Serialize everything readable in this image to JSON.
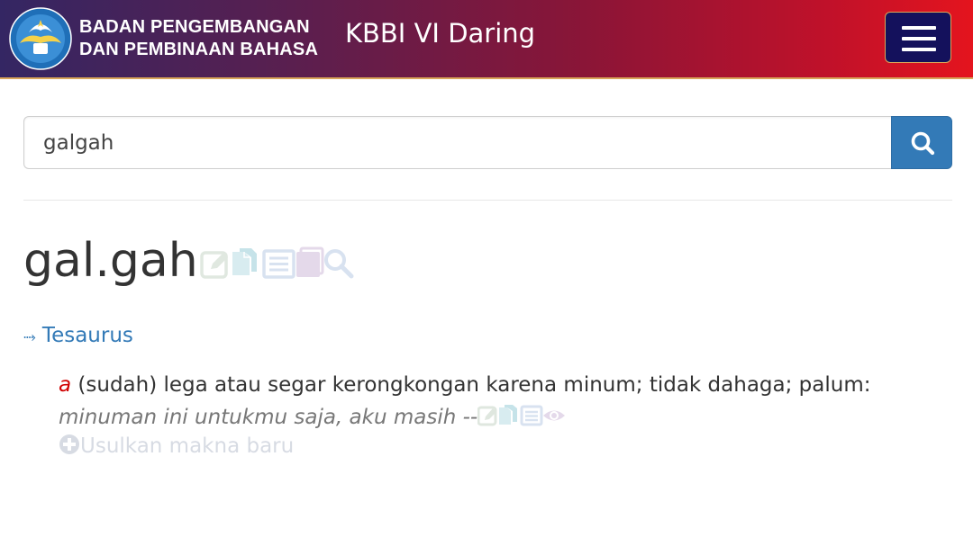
{
  "header": {
    "org_line1": "BADAN PENGEMBANGAN",
    "org_line2": "DAN PEMBINAAN BAHASA",
    "app_title": "KBBI VI Daring",
    "logo_icon": "tut-wuri-handayani-logo-icon",
    "menu_icon": "hamburger-icon"
  },
  "search": {
    "value": "galgah",
    "button_icon": "search-icon"
  },
  "entry": {
    "headword": "gal.gah",
    "tools_icons": [
      "edit-icon",
      "copy-icon",
      "list-icon",
      "book-icon",
      "search-icon"
    ],
    "tesaurus_link": "Tesaurus",
    "tesaurus_prefix": "⤑",
    "definitions": [
      {
        "pos": "a",
        "text": " (sudah) lega atau segar kerongkongan karena minum; tidak dahaga; palum: ",
        "example": "minuman ini untukmu saja, aku masih --",
        "tools_icons": [
          "edit-icon",
          "copy-icon",
          "list-icon",
          "eye-icon"
        ]
      }
    ],
    "suggest_link": "Usulkan makna baru",
    "suggest_icon": "plus-circle-icon"
  },
  "colors": {
    "header_start": "#342663",
    "header_end": "#e4141e",
    "menu_button": "#14115c",
    "primary": "#337ab7",
    "pos_red": "#d00000"
  }
}
